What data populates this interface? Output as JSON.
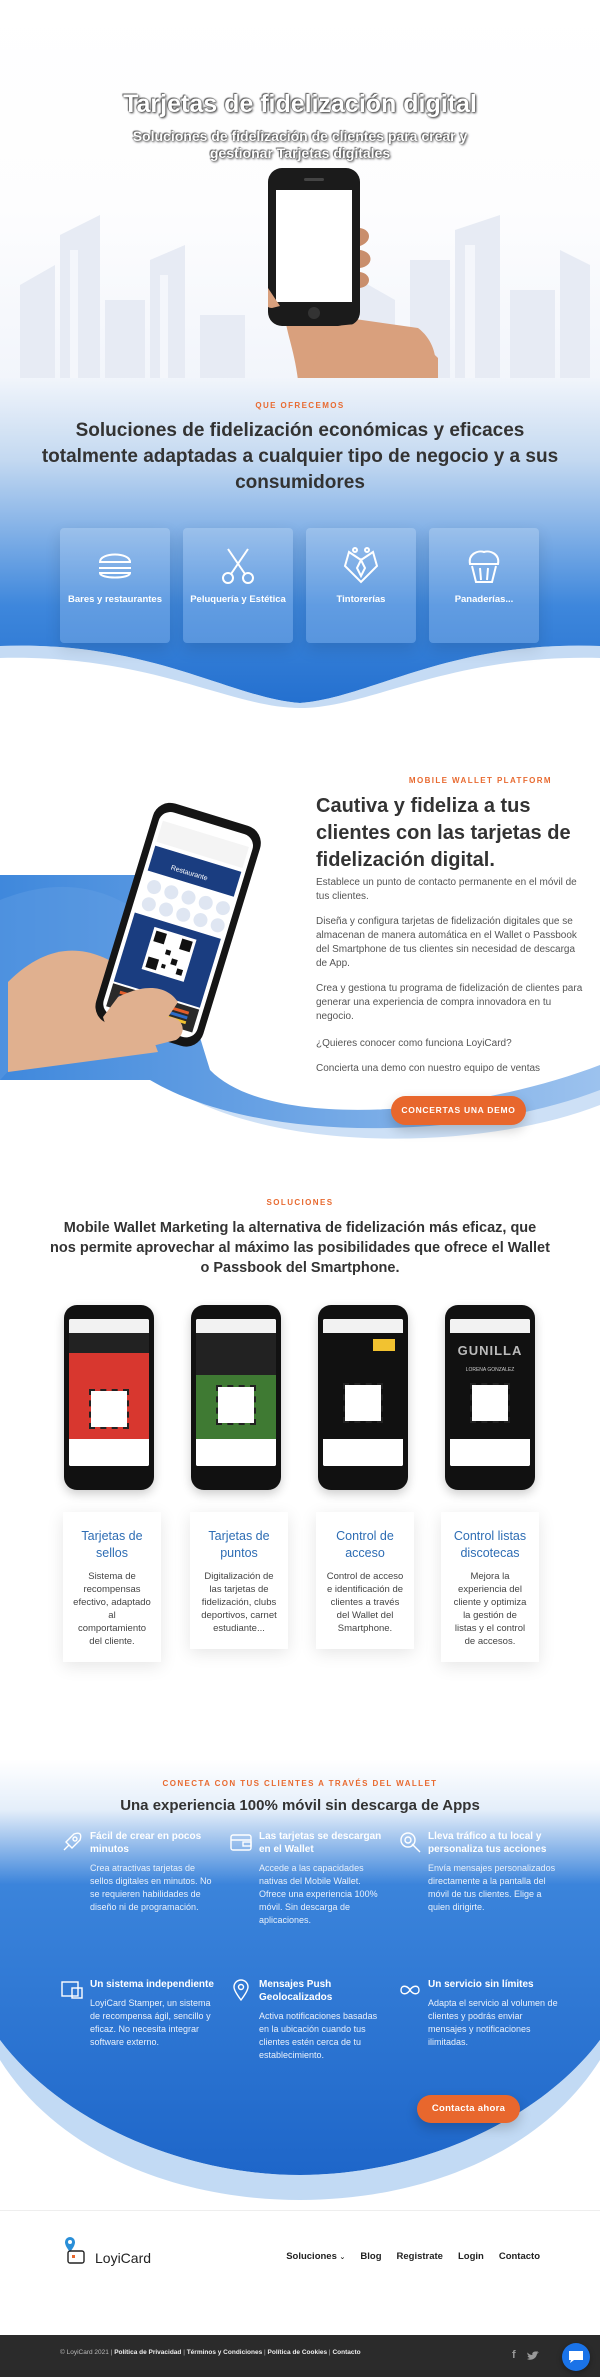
{
  "hero": {
    "title": "Tarjetas de fidelización digital",
    "subtitle": "Soluciones de fidelización de clientes para crear y gestionar Tarjetas digitales"
  },
  "offer": {
    "eyebrow": "QUE OFRECEMOS",
    "title": "Soluciones de fidelización económicas y eficaces totalmente adaptadas a cualquier tipo de negocio y a sus consumidores",
    "cards": [
      {
        "label": "Bares y restaurantes",
        "icon": "burger-icon"
      },
      {
        "label": "Peluquería y Estética",
        "icon": "scissors-icon"
      },
      {
        "label": "Tintorerías",
        "icon": "suit-icon"
      },
      {
        "label": "Panaderías...",
        "icon": "cupcake-icon"
      }
    ]
  },
  "wallet": {
    "eyebrow": "MOBILE WALLET PLATFORM",
    "title": "Cautiva y fideliza a tus clientes con las tarjetas de fidelización digital.",
    "paragraphs": [
      "Establece un punto de contacto permanente en el móvil de tus clientes.",
      "Diseña y configura tarjetas de fidelización digitales que se almacenan de manera automática en el Wallet o Passbook del Smartphone de tus clientes sin necesidad de descarga de App.",
      "Crea y gestiona tu programa de fidelización de clientes para generar una experiencia de compra innovadora en tu negocio.",
      "¿Quieres conocer como funciona LoyiCard?",
      "Concierta una  demo con nuestro equipo de ventas"
    ],
    "button": "CONCERTAS UNA DEMO",
    "phone_header": "Restaurante"
  },
  "solutions": {
    "eyebrow": "SOLUCIONES",
    "title": "Mobile Wallet Marketing la alternativa de fidelización más eficaz, que nos permite aprovechar al máximo las posibilidades que ofrece el Wallet o Passbook del Smartphone.",
    "cards": [
      {
        "title": "Tarjetas de sellos",
        "text": "Sistema de recompensas efectivo, adaptado al comportamiento del cliente."
      },
      {
        "title": "Tarjetas de puntos",
        "text": "Digitalización de las tarjetas de fidelización, clubs deportivos, carnet estudiante..."
      },
      {
        "title": "Control de acceso",
        "text": "Control de acceso e identificación de clientes a través del Wallet del Smartphone."
      },
      {
        "title": "Control listas discotecas",
        "text": "Mejora la experiencia del cliente y optimiza la gestión de listas y el control de accesos."
      }
    ],
    "phone4_brand": "GUNILLA",
    "phone4_name": "LORENA GONZALEZ"
  },
  "app": {
    "eyebrow": "CONECTA CON TUS CLIENTES A TRAVÉS DEL WALLET",
    "title": "Una experiencia 100% móvil sin descarga de Apps",
    "features": [
      {
        "title": "Fácil de crear en pocos minutos",
        "text": "Crea atractivas tarjetas de sellos digitales en minutos. No se requieren habilidades de diseño ni de programación.",
        "icon": "rocket-icon"
      },
      {
        "title": "Las tarjetas se descargan en el Wallet",
        "text": "Accede a las capacidades nativas del Mobile Wallet. Ofrece una experiencia 100% móvil. Sin descarga de aplicaciones.",
        "icon": "wallet-icon"
      },
      {
        "title": "Lleva tráfico a tu local y personaliza tus acciones",
        "text": "Envía mensajes personalizados directamente a la pantalla del móvil de tus clientes. Elige a quien dirigirte.",
        "icon": "target-icon"
      },
      {
        "title": "Un sistema independiente",
        "text": "LoyiCard Stamper, un sistema de recompensa ágil, sencillo y eficaz. No necesita integrar software externo.",
        "icon": "stamper-icon"
      },
      {
        "title": "Mensajes Push Geolocalizados",
        "text": "Activa notificaciones basadas en la ubicación cuando tus clientes estén cerca de tu establecimiento.",
        "icon": "location-icon"
      },
      {
        "title": "Un servicio sin límites",
        "text": "Adapta el servicio al volumen de clientes y podrás enviar mensajes y notificaciones ilimitadas.",
        "icon": "infinity-icon"
      }
    ],
    "button": "Contacta ahora"
  },
  "footer": {
    "logo": "LoyiCard",
    "nav": [
      "Soluciones",
      "Blog",
      "Registrate",
      "Login",
      "Contacto"
    ],
    "copyright": "© LoyiCard 2021 |",
    "links": [
      "Política de Privacidad",
      "Términos y Condiciones",
      "Política de Cookies",
      "Contacto"
    ]
  },
  "colors": {
    "accent": "#e8672d",
    "blue": "#2a78d6",
    "title_blue": "#2e6db4"
  }
}
